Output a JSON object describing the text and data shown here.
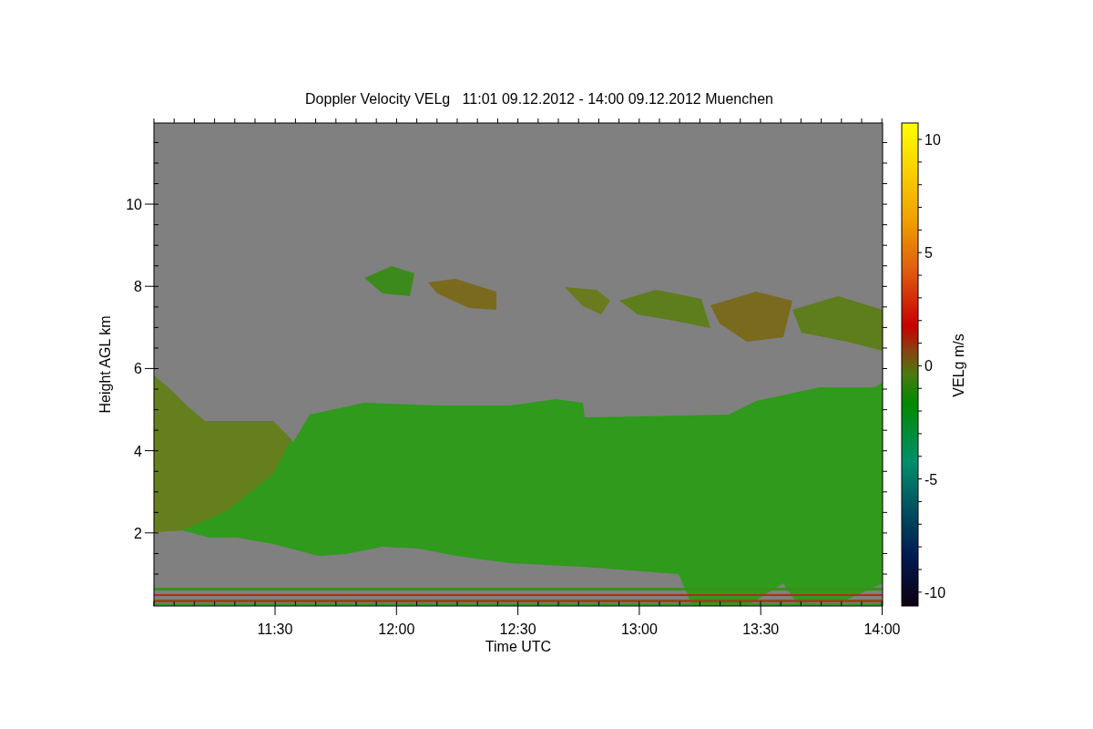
{
  "title": "Doppler Velocity VELg   11:01 09.12.2012 - 14:00 09.12.2012 Muenchen",
  "plot": {
    "ylabel": "Height AGL km",
    "xlabel": "Time UTC",
    "yticks": [
      "10",
      "8",
      "6",
      "4",
      "2"
    ],
    "xticks": [
      "11:30",
      "12:00",
      "12:30",
      "13:00",
      "13:30",
      "14:00"
    ]
  },
  "colorbar": {
    "label": "VELg m/s",
    "ticks": [
      "10",
      "5",
      "0",
      "-5",
      "-10"
    ]
  }
}
